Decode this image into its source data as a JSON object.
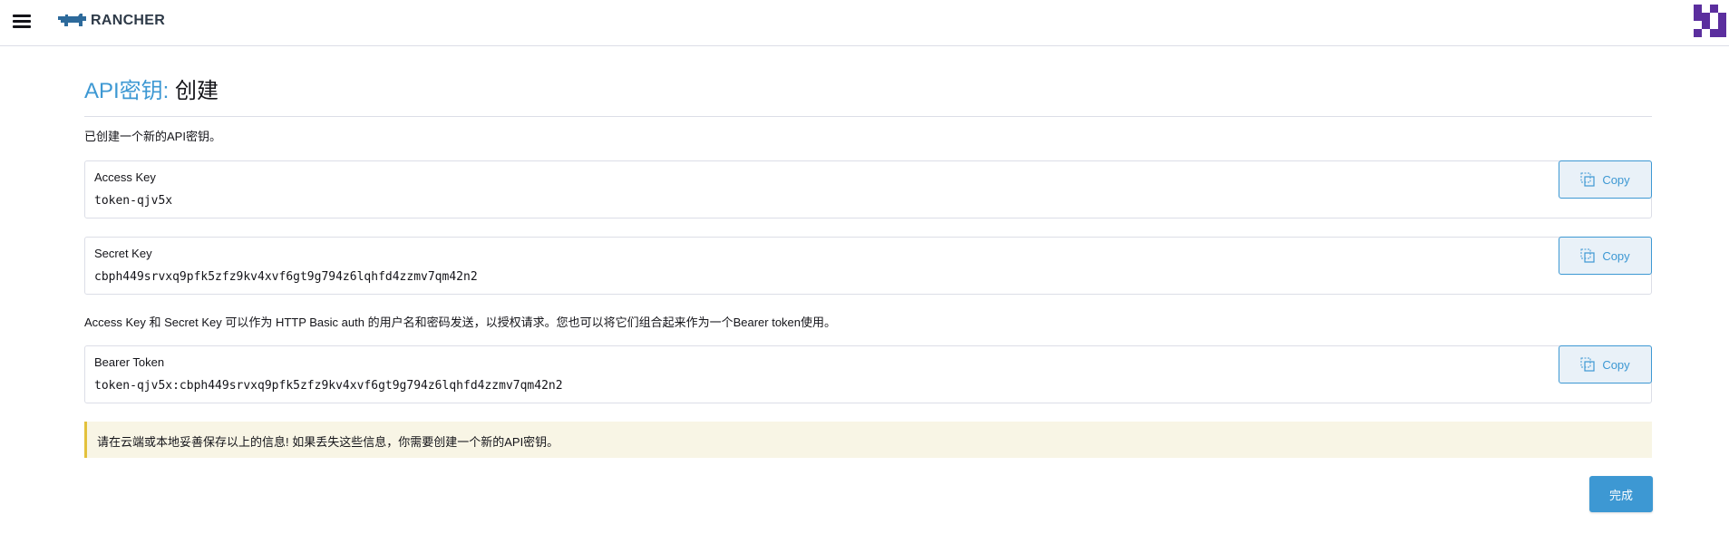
{
  "header": {
    "logo_text": "RANCHER",
    "menu_icon": "hamburger-menu-icon",
    "avatar_icon": "user-avatar-icon"
  },
  "page": {
    "title_prefix": "API密钥:",
    "title_suffix": "创建",
    "created_message": "已创建一个新的API密钥。"
  },
  "keys": {
    "access": {
      "label": "Access Key",
      "value": "token-qjv5x",
      "copy_label": "Copy"
    },
    "secret": {
      "label": "Secret Key",
      "value": "cbph449srvxq9pfk5zfz9kv4xvf6gt9g794z6lqhfd4zzmv7qm42n2",
      "copy_label": "Copy"
    },
    "bearer": {
      "label": "Bearer Token",
      "value": "token-qjv5x:cbph449srvxq9pfk5zfz9kv4xvf6gt9g794z6lqhfd4zzmv7qm42n2",
      "copy_label": "Copy"
    }
  },
  "info_text": "Access Key 和 Secret Key 可以作为 HTTP Basic auth 的用户名和密码发送，以授权请求。您也可以将它们组合起来作为一个Bearer token使用。",
  "warning_text": "请在云端或本地妥善保存以上的信息! 如果丢失这些信息，你需要创建一个新的API密钥。",
  "done_label": "完成",
  "colors": {
    "accent": "#3d98d3",
    "warning_border": "#e3c13c",
    "warning_bg": "#f8f5e5",
    "avatar": "#5b2e9e"
  }
}
